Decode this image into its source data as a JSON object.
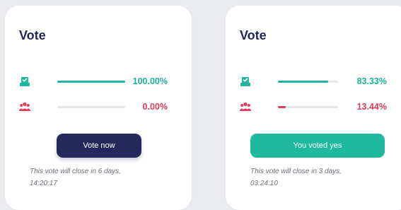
{
  "cards": [
    {
      "title": "Vote",
      "yes": {
        "percent_label": "100.00%",
        "fraction": 1.0,
        "icon": "ballot-box-icon"
      },
      "no": {
        "percent_label": "0.00%",
        "fraction": 0.0,
        "icon": "users-icon"
      },
      "button_label": "Vote now",
      "close_line1": "This vote will close in 6 days,",
      "close_line2": "14:20:17"
    },
    {
      "title": "Vote",
      "yes": {
        "percent_label": "83.33%",
        "fraction": 0.8333,
        "icon": "ballot-box-icon"
      },
      "no": {
        "percent_label": "13.44%",
        "fraction": 0.1344,
        "icon": "users-icon"
      },
      "button_label": "You voted yes",
      "close_line1": "This vote will close in 3 days,",
      "close_line2": "03:24:10"
    }
  ],
  "colors": {
    "yes": "#1fb5a0",
    "no": "#e43a5c",
    "primary_button": "#23295a",
    "voted_button": "#1fb99e",
    "title": "#22285a"
  }
}
